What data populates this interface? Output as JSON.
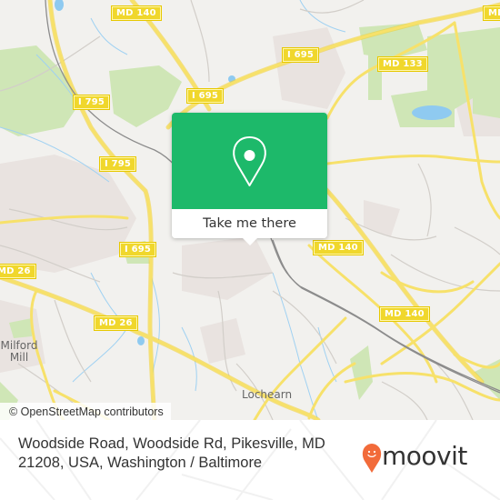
{
  "map": {
    "road_shields": [
      {
        "id": "md140-top",
        "label": "MD 140"
      },
      {
        "id": "md140-right",
        "label": "MD 140"
      },
      {
        "id": "md140-mid",
        "label": "MD 140"
      },
      {
        "id": "md140-lower",
        "label": "MD 140"
      },
      {
        "id": "i695-top-left",
        "label": "I 695"
      },
      {
        "id": "i695-top-right",
        "label": "I 695"
      },
      {
        "id": "i695-left",
        "label": "I 695"
      },
      {
        "id": "md133",
        "label": "MD 133"
      },
      {
        "id": "i795-upper",
        "label": "I 795"
      },
      {
        "id": "i795-lower",
        "label": "I 795"
      },
      {
        "id": "md26-left",
        "label": "MD 26"
      },
      {
        "id": "md26-mid",
        "label": "MD 26"
      },
      {
        "id": "md-edge",
        "label": "MD"
      }
    ],
    "places": [
      {
        "id": "milford-mill",
        "label": "Milford\nMill"
      },
      {
        "id": "lochearn",
        "label": "Lochearn"
      }
    ],
    "attribution": "© OpenStreetMap contributors",
    "colors": {
      "background": "#f2f1ee",
      "major_road": "#f6df5c",
      "minor_road": "#d4d0cc",
      "water": "#8cc8ec",
      "park": "#c9e3ad",
      "rail": "#8a8a8a",
      "urban": "#e8e2df"
    }
  },
  "popup": {
    "icon": "location-pin-icon",
    "button_label": "Take me there",
    "color": "#1db96a"
  },
  "footer": {
    "address": "Woodside Road, Woodside Rd, Pikesville, MD 21208, USA, Washington / Baltimore",
    "brand": "moovit",
    "brand_color": "#f26b3a"
  }
}
